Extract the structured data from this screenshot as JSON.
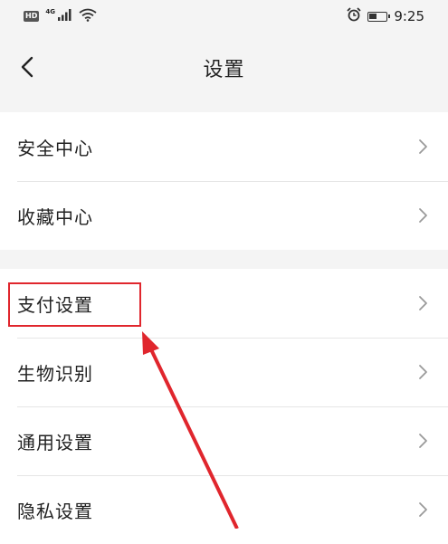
{
  "status_bar": {
    "hd_badge": "HD",
    "network": "4G",
    "time": "9:25",
    "battery_level": 0.45,
    "icons": [
      "hd-icon",
      "signal-icon",
      "wifi-icon",
      "alarm-icon",
      "battery-icon"
    ]
  },
  "nav": {
    "title": "设置",
    "back_icon": "chevron-left-icon"
  },
  "groups": [
    {
      "items": [
        {
          "label": "安全中心"
        },
        {
          "label": "收藏中心"
        }
      ]
    },
    {
      "items": [
        {
          "label": "支付设置",
          "highlighted": true
        },
        {
          "label": "生物识别"
        },
        {
          "label": "通用设置"
        },
        {
          "label": "隐私设置"
        }
      ]
    }
  ],
  "annotation": {
    "highlight_color": "#e0262d",
    "target": "支付设置"
  },
  "colors": {
    "background": "#f4f4f4",
    "card": "#ffffff",
    "divider": "#e6e6e6",
    "chevron": "#9a9a9a"
  }
}
